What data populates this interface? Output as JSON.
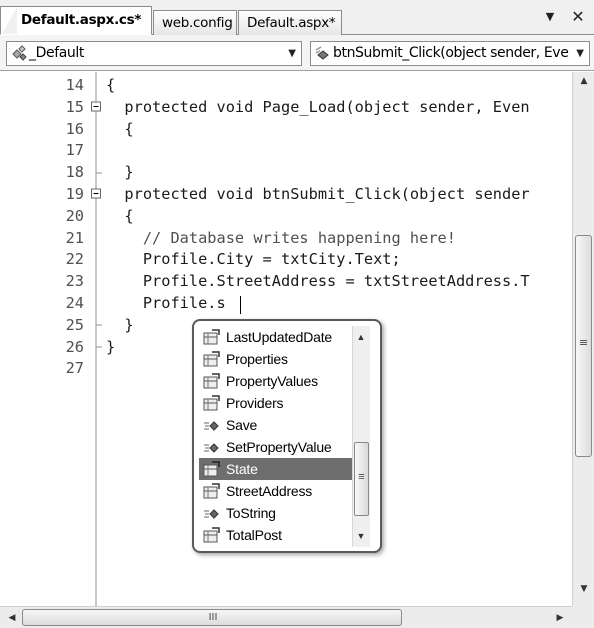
{
  "tabs": [
    {
      "label": "Default.aspx.cs*",
      "active": true
    },
    {
      "label": "web.config",
      "active": false
    },
    {
      "label": "Default.aspx*",
      "active": false
    }
  ],
  "tab_controls": {
    "dropdown_icon": "chevron-down-icon",
    "dropdown_glyph": "▼",
    "close_icon": "close-icon",
    "close_glyph": "✕"
  },
  "navbar": {
    "class_combo": {
      "value": "_Default",
      "icon": "class-icon"
    },
    "member_combo": {
      "value": "btnSubmit_Click(object sender, Eve",
      "icon": "method-icon"
    },
    "dropdown_glyph": "▼"
  },
  "editor": {
    "line_numbers": [
      "14",
      "15",
      "16",
      "17",
      "18",
      "19",
      "20",
      "21",
      "22",
      "23",
      "24",
      "25",
      "26",
      "27"
    ],
    "lines": [
      "{",
      "  protected void Page_Load(object sender, Even",
      "  {",
      "",
      "  }",
      "  protected void btnSubmit_Click(object sender",
      "  {",
      "    // Database writes happening here!",
      "    Profile.City = txtCity.Text;",
      "    Profile.StreetAddress = txtStreetAddress.T",
      "    Profile.s",
      "  }",
      "}",
      ""
    ],
    "caret_line": 10
  },
  "intellisense": {
    "items": [
      {
        "label": "LastUpdatedDate",
        "icon": "property-icon"
      },
      {
        "label": "Properties",
        "icon": "property-icon"
      },
      {
        "label": "PropertyValues",
        "icon": "property-icon"
      },
      {
        "label": "Providers",
        "icon": "property-icon"
      },
      {
        "label": "Save",
        "icon": "method-icon"
      },
      {
        "label": "SetPropertyValue",
        "icon": "method-icon"
      },
      {
        "label": "State",
        "icon": "property-icon",
        "selected": true
      },
      {
        "label": "StreetAddress",
        "icon": "property-icon"
      },
      {
        "label": "ToString",
        "icon": "method-icon"
      },
      {
        "label": "TotalPost",
        "icon": "property-icon"
      }
    ],
    "scroll_up_glyph": "▲",
    "scroll_down_glyph": "▼",
    "grip_glyph": "≡"
  },
  "scrollbars": {
    "vertical": {
      "up_glyph": "▲",
      "down_glyph": "▼",
      "grip_glyph": "≡"
    },
    "horizontal": {
      "left_glyph": "◀",
      "right_glyph": "▶",
      "grip_glyph": "III"
    }
  },
  "colors": {
    "selection": "#6e6e6e",
    "comment": "#505050",
    "line_numbers": "#505050"
  }
}
